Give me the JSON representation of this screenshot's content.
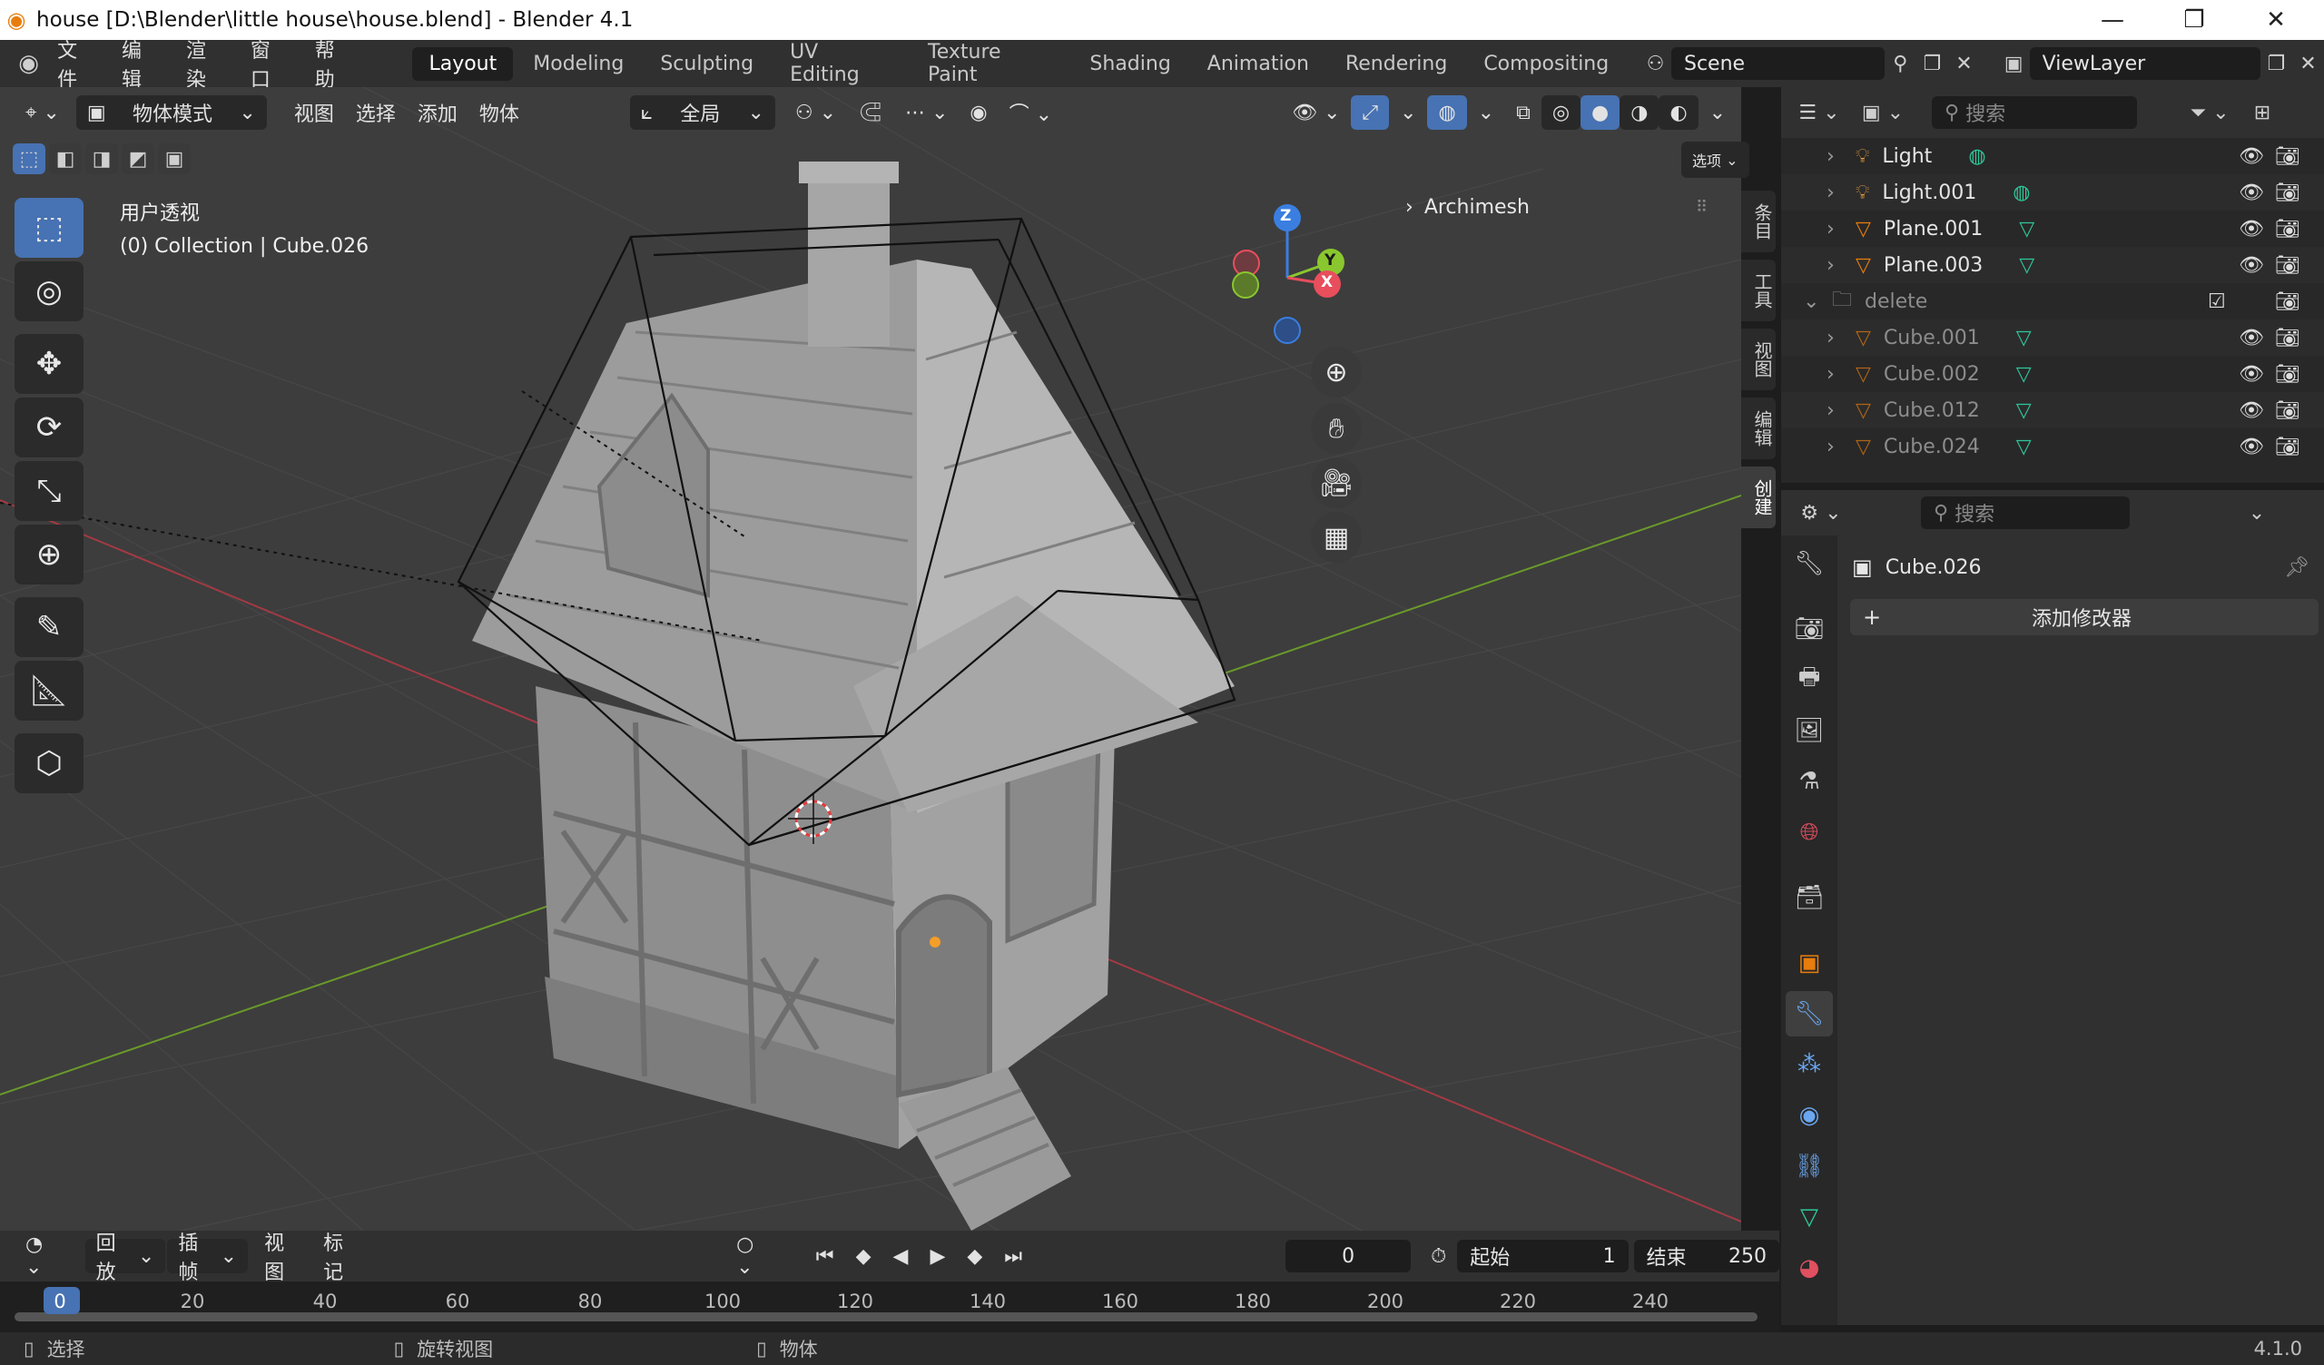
{
  "window": {
    "title": "house [D:\\Blender\\little house\\house.blend] - Blender 4.1",
    "minimize": "—",
    "maximize": "❐",
    "close": "✕"
  },
  "menu": [
    "文件",
    "编辑",
    "渲染",
    "窗口",
    "帮助"
  ],
  "workspaces": [
    "Layout",
    "Modeling",
    "Sculpting",
    "UV Editing",
    "Texture Paint",
    "Shading",
    "Animation",
    "Rendering",
    "Compositing"
  ],
  "active_workspace": "Layout",
  "scene": {
    "name": "Scene"
  },
  "view_layer": {
    "name": "ViewLayer"
  },
  "viewport_header": {
    "mode": "物体模式",
    "menus": [
      "视图",
      "选择",
      "添加",
      "物体"
    ],
    "transform_orientation": "全局",
    "options_label": "选项"
  },
  "viewport": {
    "view_name": "用户透视",
    "collection_info": "(0) Collection | Cube.026",
    "panel_label": "Archimesh",
    "gizmo": {
      "z": "Z",
      "y": "Y",
      "x": "X"
    }
  },
  "side_tabs": [
    "条目",
    "工具",
    "视图",
    "编辑",
    "创建"
  ],
  "outliner": {
    "search_placeholder": "搜索",
    "rows": [
      {
        "name": "Light",
        "type": "light",
        "dim": false
      },
      {
        "name": "Light.001",
        "type": "light",
        "dim": false
      },
      {
        "name": "Plane.001",
        "type": "mesh",
        "dim": false
      },
      {
        "name": "Plane.003",
        "type": "mesh",
        "dim": false
      },
      {
        "name": "delete",
        "type": "collection",
        "dim": true
      },
      {
        "name": "Cube.001",
        "type": "mesh",
        "dim": true
      },
      {
        "name": "Cube.002",
        "type": "mesh",
        "dim": true
      },
      {
        "name": "Cube.012",
        "type": "mesh",
        "dim": true
      },
      {
        "name": "Cube.024",
        "type": "mesh",
        "dim": true
      }
    ]
  },
  "properties": {
    "search_placeholder": "搜索",
    "object_name": "Cube.026",
    "add_modifier_label": "添加修改器"
  },
  "timeline": {
    "menus": [
      "回放",
      "插帧",
      "视图",
      "标记"
    ],
    "current_frame": "0",
    "start_label": "起始",
    "start_value": "1",
    "end_label": "结束",
    "end_value": "250",
    "ticks": [
      "0",
      "20",
      "40",
      "60",
      "80",
      "100",
      "120",
      "140",
      "160",
      "180",
      "200",
      "220",
      "240"
    ]
  },
  "statusbar": {
    "select": "选择",
    "rotate": "旋转视图",
    "object": "物体",
    "version": "4.1.0"
  },
  "colors": {
    "accent": "#4772b3",
    "x_axis": "#e84e5c",
    "y_axis": "#8ac72e",
    "z_axis": "#3a7ee0",
    "orange": "#e87d0d"
  }
}
